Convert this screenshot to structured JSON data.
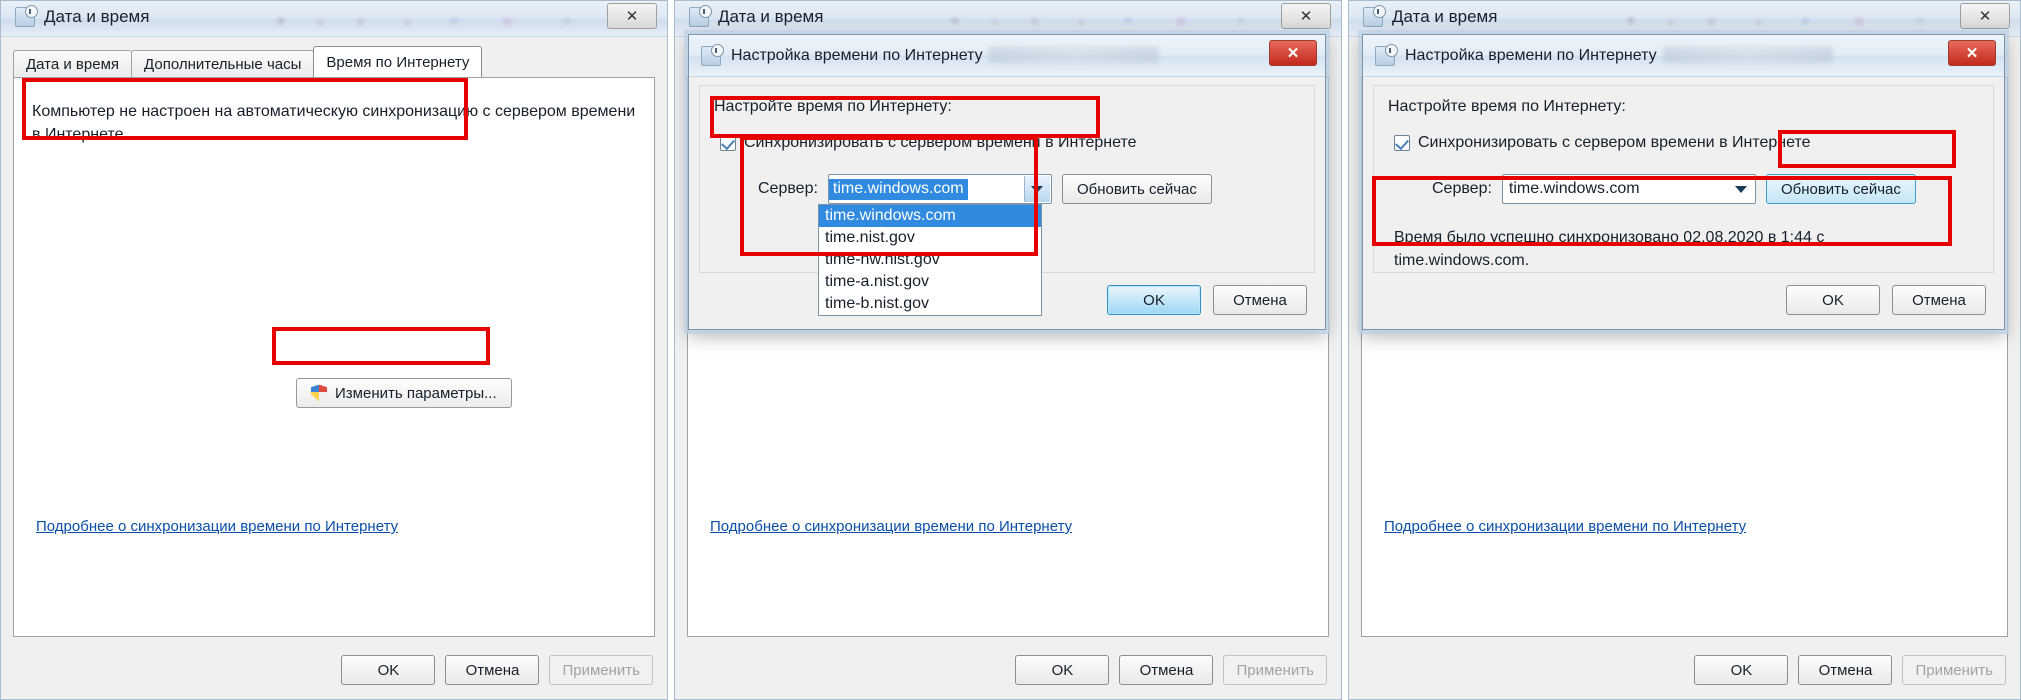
{
  "common": {
    "base_window_title": "Дата и время",
    "dialog_title": "Настройка времени по Интернету",
    "close_glyph": "✕",
    "tabs": [
      {
        "label": "Дата и время"
      },
      {
        "label": "Дополнительные часы"
      },
      {
        "label": "Время по Интернету"
      }
    ],
    "help_link": "Подробнее о синхронизации времени по Интернету",
    "ok_label": "OK",
    "cancel_label": "Отмена",
    "apply_label": "Применить",
    "dialog_intro": "Настройте время по Интернету:",
    "sync_checkbox_label": "Синхронизировать с сервером времени в Интернете",
    "server_label": "Сервер:",
    "update_now_label": "Обновить сейчас",
    "server_value": "time.windows.com",
    "accent_red": "#e60000",
    "link_color": "#0a4ea8",
    "select_blue": "#2f8ae0"
  },
  "panel1": {
    "notice_text": "Компьютер не настроен на автоматическую синхронизацию с сервером времени в Интернете.",
    "change_settings_label": "Изменить параметры...",
    "active_tab_index": 2
  },
  "panel2": {
    "server_options": [
      "time.windows.com",
      "time.nist.gov",
      "time-nw.nist.gov",
      "time-a.nist.gov",
      "time-b.nist.gov"
    ],
    "selected_option_index": 0
  },
  "panel3": {
    "status_message": "Время было успешно синхронизовано 02.08.2020 в 1:44 с time.windows.com."
  }
}
